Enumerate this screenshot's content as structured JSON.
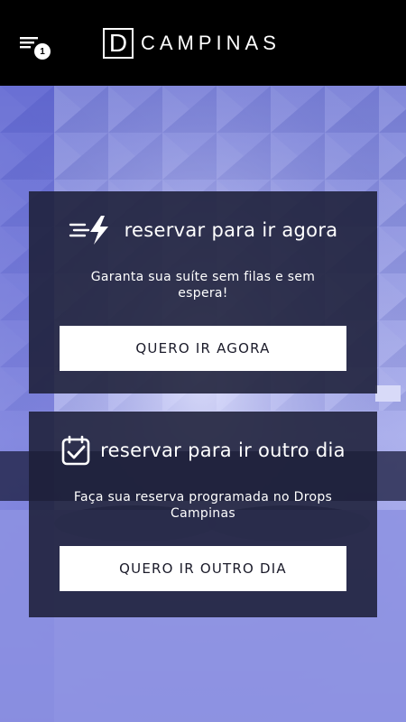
{
  "header": {
    "logo_letter": "D",
    "logo_text": "CAMPINAS",
    "menu_badge": "1"
  },
  "cards": [
    {
      "icon": "bolt-speed-icon",
      "title": "reservar para ir agora",
      "description": "Garanta sua suíte sem filas e sem espera!",
      "button": "QUERO IR AGORA"
    },
    {
      "icon": "calendar-check-icon",
      "title": "reservar para ir outro dia",
      "description": "Faça sua reserva programada no Drops Campinas",
      "button": "QUERO IR OUTRO DIA"
    }
  ],
  "colors": {
    "header_bg": "#000000",
    "card_bg": "#1c1f38",
    "button_bg": "#ffffff",
    "accent_background": "#8a8ee0"
  }
}
